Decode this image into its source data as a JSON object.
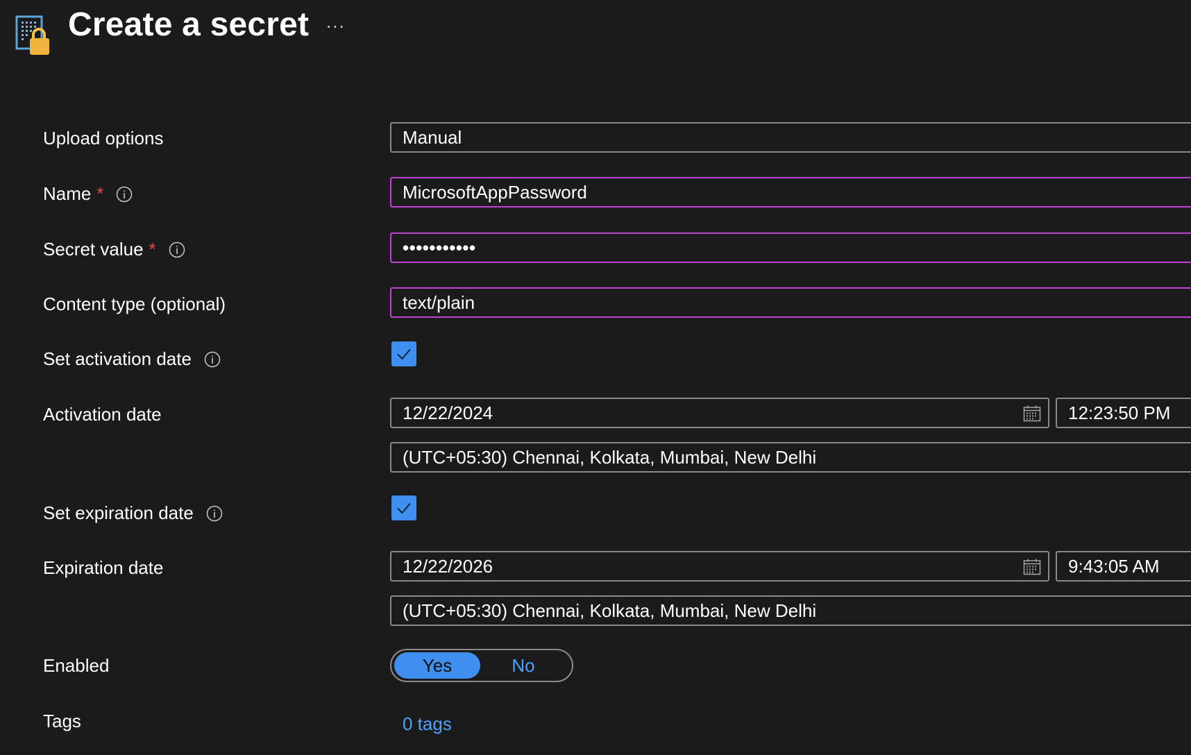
{
  "header": {
    "title": "Create a secret",
    "more_label": "...",
    "icon": "key-vault-lock-icon"
  },
  "form": {
    "upload_options": {
      "label": "Upload options",
      "value": "Manual"
    },
    "name": {
      "label": "Name",
      "required_mark": "*",
      "value": "MicrosoftAppPassword"
    },
    "secret_value": {
      "label": "Secret value",
      "required_mark": "*",
      "value": "•••••••••••"
    },
    "content_type": {
      "label": "Content type (optional)",
      "value": "text/plain"
    },
    "set_activation": {
      "label": "Set activation date",
      "checked": true
    },
    "activation_date": {
      "label": "Activation date",
      "date": "12/22/2024",
      "time": "12:23:50 PM",
      "timezone": "(UTC+05:30) Chennai, Kolkata, Mumbai, New Delhi"
    },
    "set_expiration": {
      "label": "Set expiration date",
      "checked": true
    },
    "expiration_date": {
      "label": "Expiration date",
      "date": "12/22/2026",
      "time": "9:43:05 AM",
      "timezone": "(UTC+05:30) Chennai, Kolkata, Mumbai, New Delhi"
    },
    "enabled": {
      "label": "Enabled",
      "yes": "Yes",
      "no": "No",
      "selected": "Yes"
    },
    "tags": {
      "label": "Tags",
      "link": "0 tags"
    }
  },
  "colors": {
    "background": "#1b1b1b",
    "accent": "#3f8ff0",
    "focus_border": "#c043d6",
    "link": "#4ea2ff",
    "required": "#e04a4a"
  }
}
